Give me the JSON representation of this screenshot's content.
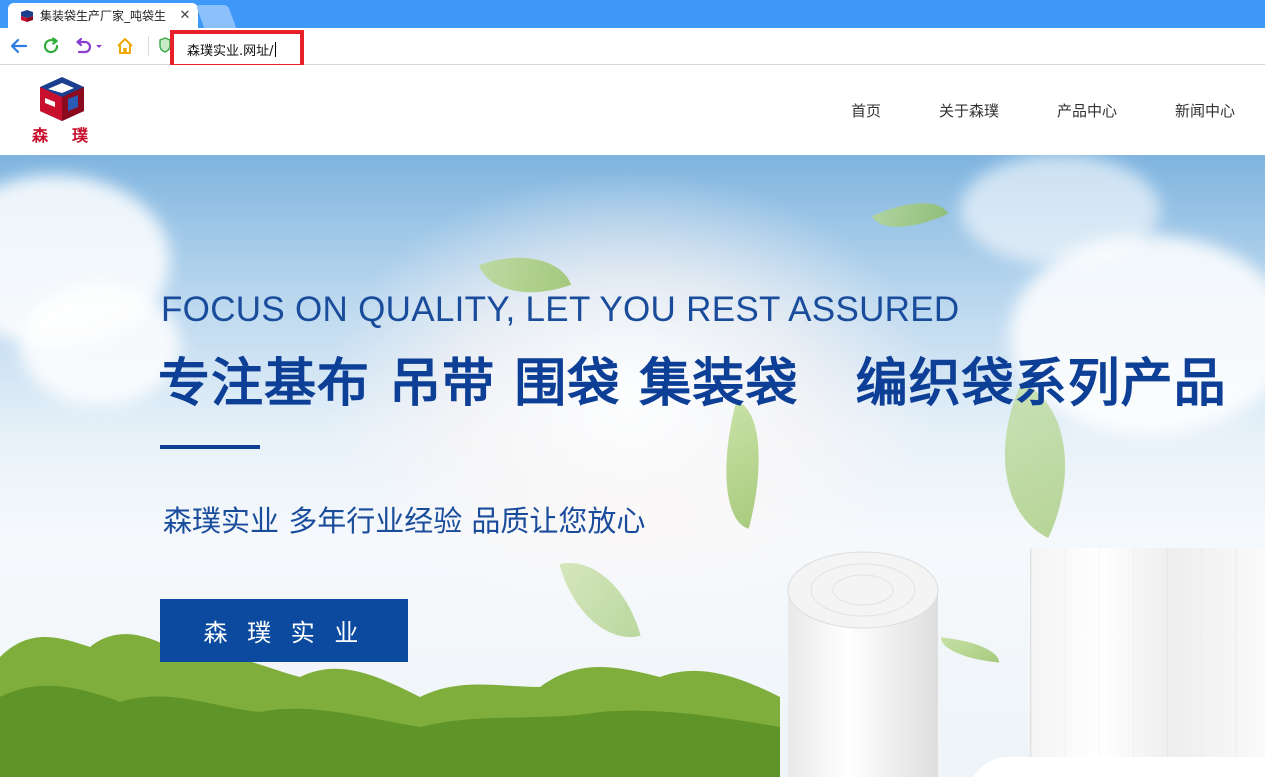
{
  "browser": {
    "tab": {
      "title": "集装袋生产厂家_吨袋生",
      "close_icon": "close-icon",
      "favicon": "site-logo-icon"
    },
    "toolbar": {
      "back_icon": "arrow-left-icon",
      "reload_icon": "reload-icon",
      "undo_icon": "undo-dropdown-icon",
      "home_icon": "home-icon",
      "shield_icon": "shield-icon"
    },
    "address_bar": {
      "value": "森璞实业.网址/"
    }
  },
  "site": {
    "logo": {
      "text": "森 璞",
      "colors": {
        "blue": "#1a3f8f",
        "red": "#c8102e"
      }
    },
    "nav": [
      "首页",
      "关于森璞",
      "产品中心",
      "新闻中心"
    ]
  },
  "hero": {
    "tagline_en": "FOCUS ON QUALITY, LET YOU REST ASSURED",
    "headline_cn": "专注基布 吊带 围袋 集装袋   编织袋系列产品",
    "subline_cn": "森璞实业 多年行业经验 品质让您放心",
    "button_label": "森 璞 实 业",
    "colors": {
      "text": "#0d3f96",
      "button": "#0b4a9e"
    }
  }
}
